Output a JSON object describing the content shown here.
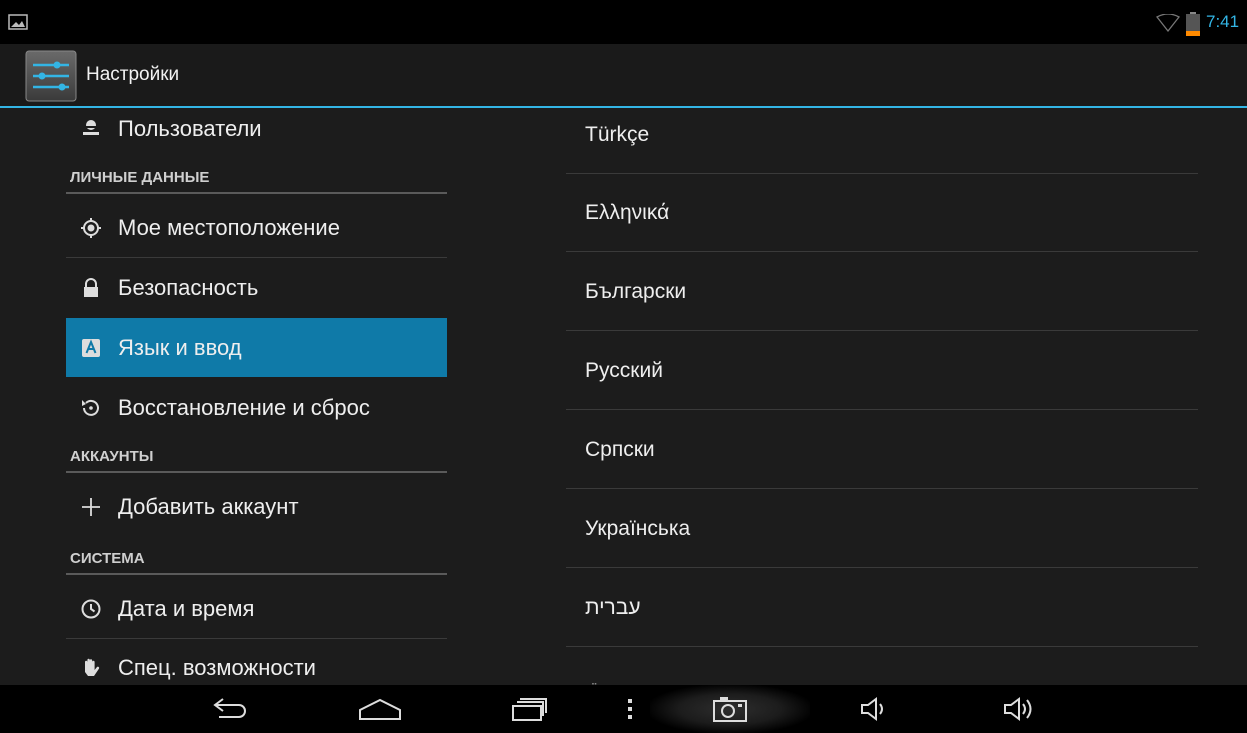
{
  "status_bar": {
    "time": "7:41",
    "icons": [
      "gallery-icon",
      "wifi-icon",
      "battery-icon"
    ],
    "accent_color": "#33b5e5",
    "battery_color": "#ff8a00"
  },
  "action_bar": {
    "title": "Настройки",
    "icon": "settings-sliders-icon"
  },
  "sidebar": {
    "items": [
      {
        "type": "item",
        "label": "Пользователи",
        "icon": "user-icon"
      },
      {
        "type": "header",
        "label": "ЛИЧНЫЕ ДАННЫЕ"
      },
      {
        "type": "item",
        "label": "Мое местоположение",
        "icon": "location-icon"
      },
      {
        "type": "item",
        "label": "Безопасность",
        "icon": "lock-icon"
      },
      {
        "type": "item",
        "label": "Язык и ввод",
        "icon": "language-icon",
        "selected": true
      },
      {
        "type": "item",
        "label": "Восстановление и сброс",
        "icon": "restore-icon"
      },
      {
        "type": "header",
        "label": "АККАУНТЫ"
      },
      {
        "type": "item",
        "label": "Добавить аккаунт",
        "icon": "plus-icon"
      },
      {
        "type": "header",
        "label": "СИСТЕМА"
      },
      {
        "type": "item",
        "label": "Дата и время",
        "icon": "clock-icon"
      },
      {
        "type": "item",
        "label": "Спец. возможности",
        "icon": "hand-icon"
      }
    ],
    "selected_color": "#0f7aa8"
  },
  "language_list": {
    "items": [
      "Türkçe",
      "Ελληνικά",
      "Български",
      "Русский",
      "Српски",
      "Українська",
      "עברית"
    ]
  },
  "nav_bar": {
    "buttons": [
      "back-icon",
      "home-icon",
      "recents-icon",
      "menu-icon",
      "screenshot-icon",
      "volume-down-icon",
      "volume-up-icon"
    ]
  }
}
